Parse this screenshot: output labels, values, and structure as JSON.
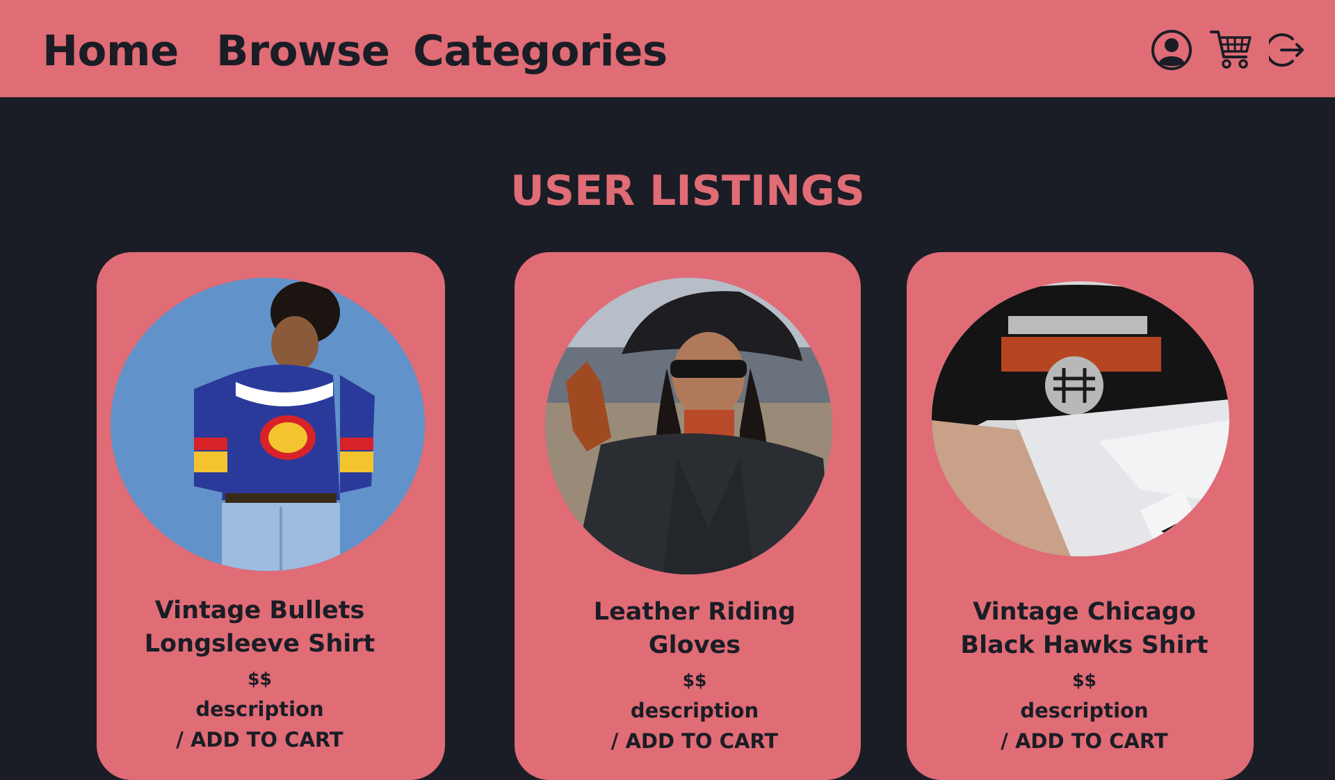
{
  "nav": {
    "home": "Home",
    "browse": "Browse",
    "categories": "Categories",
    "icons": [
      "profile-icon",
      "cart-icon",
      "logout-icon"
    ]
  },
  "colors": {
    "accent": "#e06c76",
    "background": "#1a1d25",
    "text_dark": "#1a1d25"
  },
  "main": {
    "title": "USER LISTINGS"
  },
  "listings": [
    {
      "title_line1": "Vintage Bullets",
      "title_line2": "Longsleeve Shirt",
      "price": "$$",
      "description": "description",
      "cart": "/ ADD TO CART"
    },
    {
      "title_line1": "Leather Riding",
      "title_line2": "Gloves",
      "price": "$$",
      "description": "description",
      "cart": "/ ADD TO CART"
    },
    {
      "title_line1": "Vintage Chicago",
      "title_line2": "Black Hawks Shirt",
      "price": "$$",
      "description": "description",
      "cart": "/ ADD TO CART"
    }
  ]
}
